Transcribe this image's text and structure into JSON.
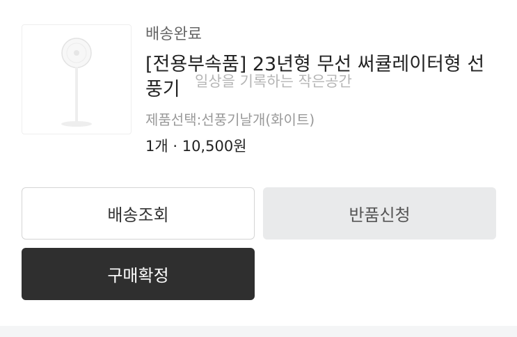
{
  "order_item": {
    "status": "배송완료",
    "product_title": "[전용부속품] 23년형 무선 써큘레이터형 선풍기",
    "watermark": "일상을 기록하는 작은공간",
    "option": "제품선택:선풍기날개(화이트)",
    "qty_price": "1개 · 10,500원",
    "image_icon": "standing-fan-icon"
  },
  "actions": {
    "track_label": "배송조회",
    "return_label": "반품신청",
    "confirm_label": "구매확정"
  },
  "colors": {
    "confirm_bg": "#2f2f2f",
    "return_bg": "#e9eaeb",
    "status_text": "#666666",
    "option_text": "#999999"
  }
}
